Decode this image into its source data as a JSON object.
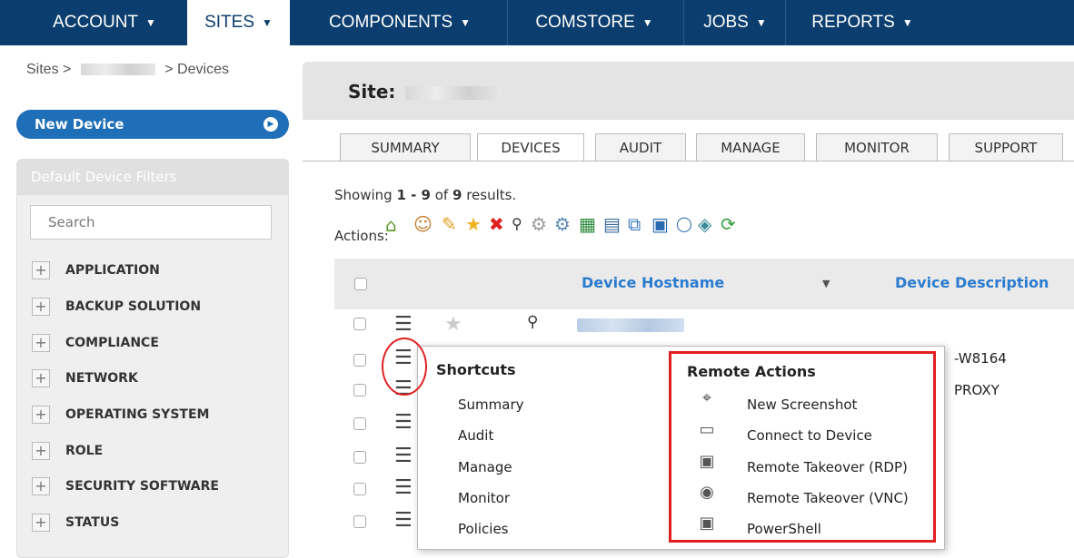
{
  "nav": {
    "items": [
      {
        "label": "ACCOUNT"
      },
      {
        "label": "SITES"
      },
      {
        "label": "COMPONENTS"
      },
      {
        "label": "COMSTORE"
      },
      {
        "label": "JOBS"
      },
      {
        "label": "REPORTS"
      }
    ],
    "caret": "▼"
  },
  "breadcrumb": {
    "root": "Sites >",
    "sep": "> Devices"
  },
  "sidebar": {
    "new_device_label": "New Device",
    "filters_title": "Default Device Filters",
    "search_placeholder": "Search",
    "filters": [
      {
        "label": "APPLICATION"
      },
      {
        "label": "BACKUP SOLUTION"
      },
      {
        "label": "COMPLIANCE"
      },
      {
        "label": "NETWORK"
      },
      {
        "label": "OPERATING SYSTEM"
      },
      {
        "label": "ROLE"
      },
      {
        "label": "SECURITY SOFTWARE"
      },
      {
        "label": "STATUS"
      }
    ]
  },
  "site": {
    "label": "Site:"
  },
  "tabs": [
    {
      "label": "SUMMARY"
    },
    {
      "label": "DEVICES"
    },
    {
      "label": "AUDIT"
    },
    {
      "label": "MANAGE"
    },
    {
      "label": "MONITOR"
    },
    {
      "label": "SUPPORT"
    }
  ],
  "results": {
    "prefix": "Showing ",
    "range": "1 - 9",
    "suffix": " of ",
    "total": "9",
    "end": " results."
  },
  "actions_label": "Actions:",
  "table": {
    "col_hostname": "Device Hostname",
    "col_desc": "Device Description",
    "row2_desc": "-W8164",
    "row3_desc": "PROXY"
  },
  "popup": {
    "shortcuts_title": "Shortcuts",
    "shortcuts": [
      {
        "label": "Summary"
      },
      {
        "label": "Audit"
      },
      {
        "label": "Manage"
      },
      {
        "label": "Monitor"
      },
      {
        "label": "Policies"
      }
    ],
    "remote_title": "Remote Actions",
    "remote": [
      {
        "label": "New Screenshot",
        "icon": "crosshair-icon"
      },
      {
        "label": "Connect to Device",
        "icon": "monitor-icon"
      },
      {
        "label": "Remote Takeover (RDP)",
        "icon": "rdp-icon"
      },
      {
        "label": "Remote Takeover (VNC)",
        "icon": "eye-icon"
      },
      {
        "label": "PowerShell",
        "icon": "powershell-icon"
      }
    ]
  },
  "colors": {
    "nav_bg": "#0b3e6e",
    "button_blue": "#1f6fb8",
    "link_blue": "#2b7bd0",
    "highlight_red": "#e02020"
  }
}
